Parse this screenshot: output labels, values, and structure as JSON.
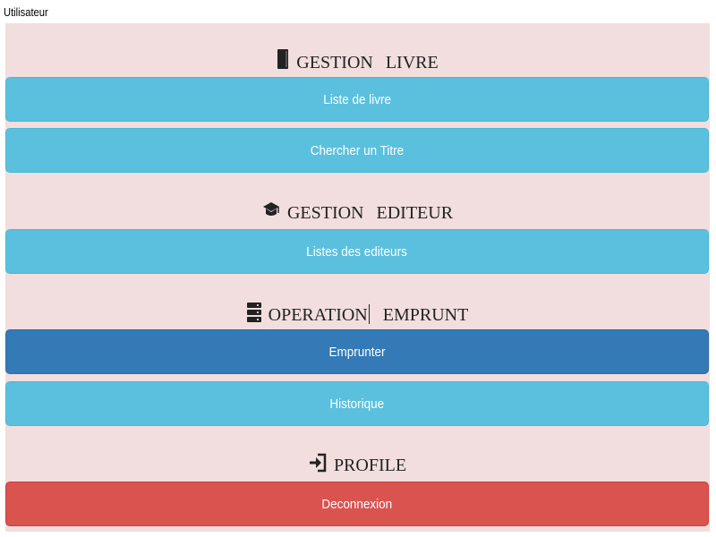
{
  "header": {
    "user_label": "Utilisateur"
  },
  "sections": {
    "livre": {
      "icon": "book-icon",
      "title_a": "GESTION",
      "title_b": "LIVRE",
      "buttons": {
        "liste": "Liste de livre",
        "chercher": "Chercher un Titre"
      }
    },
    "editeur": {
      "icon": "graduation-cap-icon",
      "title_a": "GESTION",
      "title_b": "EDITEUR",
      "buttons": {
        "listes": "Listes des editeurs"
      }
    },
    "emprunt": {
      "icon": "server-icon",
      "title_a": "OPERATION",
      "title_b": "EMPRUNT",
      "buttons": {
        "emprunter": "Emprunter",
        "historique": "Historique"
      }
    },
    "profile": {
      "icon": "sign-in-icon",
      "title": "PROFILE",
      "buttons": {
        "deconnexion": "Deconnexion"
      }
    }
  },
  "colors": {
    "panel_bg": "#f2dede",
    "info": "#5bc0de",
    "primary": "#337ab7",
    "danger": "#d9534f"
  }
}
